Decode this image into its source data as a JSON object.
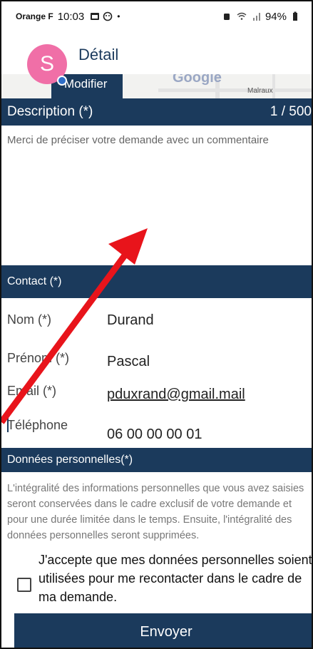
{
  "status_bar": {
    "carrier": "Orange F",
    "time": "10:03",
    "battery": "94%"
  },
  "header": {
    "title": "Détail",
    "avatar_letter": "S",
    "modify_label": "Modifier",
    "map_label": "Google",
    "map_small_label": "Malraux"
  },
  "description": {
    "label": "Description (*)",
    "counter": "1 / 500",
    "placeholder": "Merci de préciser votre demande avec un commentaire"
  },
  "contact": {
    "label": "Contact (*)",
    "fields": {
      "nom": {
        "label": "Nom (*)",
        "value": "Durand"
      },
      "prenom": {
        "label": "Prénom (*)",
        "value": "Pascal"
      },
      "email": {
        "label": "Email (*)",
        "value": "pduxrand@gmail.mail"
      },
      "telephone": {
        "label": "Téléphone",
        "value": "06 00 00 00 01"
      }
    }
  },
  "personal_data": {
    "label": "Données personnelles(*)",
    "text": "L'intégralité des informations personnelles que vous avez saisies seront conservées dans le cadre exclusif de votre demande et pour une durée limitée dans le temps. Ensuite, l'intégralité des données personnelles seront supprimées.",
    "consent_label": "J'accepte que mes données personnelles soient utilisées pour me recontacter dans le cadre de ma demande.",
    "consent_checked": false
  },
  "actions": {
    "send_label": "Envoyer"
  },
  "colors": {
    "primary": "#1b3a5c",
    "avatar": "#f06fa7",
    "annotation_arrow": "#e8141b"
  }
}
